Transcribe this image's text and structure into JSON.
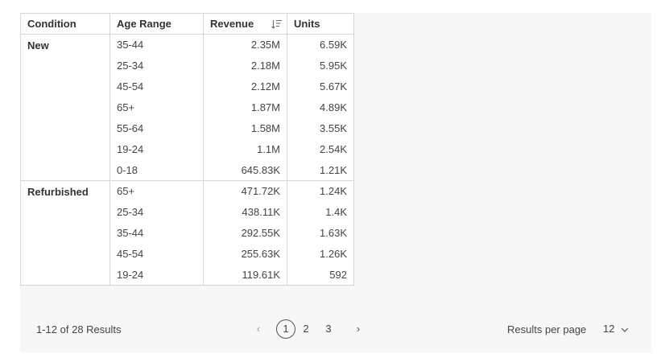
{
  "table": {
    "headers": {
      "condition": "Condition",
      "age_range": "Age Range",
      "revenue": "Revenue",
      "units": "Units"
    },
    "groups": [
      {
        "condition": "New",
        "rows": [
          {
            "age": "35-44",
            "revenue": "2.35M",
            "units": "6.59K"
          },
          {
            "age": "25-34",
            "revenue": "2.18M",
            "units": "5.95K"
          },
          {
            "age": "45-54",
            "revenue": "2.12M",
            "units": "5.67K"
          },
          {
            "age": "65+",
            "revenue": "1.87M",
            "units": "4.89K"
          },
          {
            "age": "55-64",
            "revenue": "1.58M",
            "units": "3.55K"
          },
          {
            "age": "19-24",
            "revenue": "1.1M",
            "units": "2.54K"
          },
          {
            "age": "0-18",
            "revenue": "645.83K",
            "units": "1.21K"
          }
        ]
      },
      {
        "condition": "Refurbished",
        "rows": [
          {
            "age": "65+",
            "revenue": "471.72K",
            "units": "1.24K"
          },
          {
            "age": "25-34",
            "revenue": "438.11K",
            "units": "1.4K"
          },
          {
            "age": "35-44",
            "revenue": "292.55K",
            "units": "1.63K"
          },
          {
            "age": "45-54",
            "revenue": "255.63K",
            "units": "1.26K"
          },
          {
            "age": "19-24",
            "revenue": "119.61K",
            "units": "592"
          }
        ]
      }
    ]
  },
  "footer": {
    "results_text": "1-12 of 28 Results",
    "pages": [
      "1",
      "2",
      "3"
    ],
    "current_page": "1",
    "prev_icon": "chevron-left-icon",
    "next_icon": "chevron-right-icon",
    "results_per_page_label": "Results per page",
    "results_per_page_value": "12"
  },
  "sort_icon": "sort-descending-icon"
}
